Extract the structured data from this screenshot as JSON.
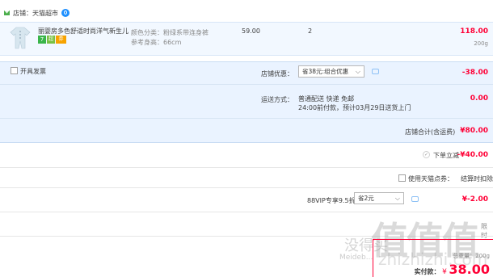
{
  "shop": {
    "label": "店铺：",
    "name": "天猫超市"
  },
  "item": {
    "title": "丽婴房多色舒适时尚洋气新生儿...",
    "spec_line1": "颜色分类：粉绿系带连身裤",
    "spec_line2": "参考身高：66cm",
    "price": "59.00",
    "qty": "2",
    "subtotal": "118.00",
    "weight": "200g",
    "badges": [
      "7",
      "超",
      "券"
    ]
  },
  "invoice": {
    "label": "开具发票"
  },
  "shop_discount": {
    "label": "店铺优惠：",
    "select": "省38元:组合优惠",
    "amount": "-38.00"
  },
  "shipping": {
    "label": "运送方式：",
    "line1": "普通配送 快递 免邮",
    "line2": "24:00前付款，预计03月29日送货上门",
    "amount": "0.00"
  },
  "shop_total": {
    "label": "店铺合计(含运费)",
    "amount": "¥80.00"
  },
  "instant_discount": {
    "label": "下单立减",
    "amount": "-¥40.00"
  },
  "tmall_points": {
    "label": "使用天猫点券：",
    "right": "结算时扣除"
  },
  "vip": {
    "label": "88VIP专享9.5折",
    "select": "省2元",
    "amount": "¥-2.00"
  },
  "summary": {
    "partial_right": "限时",
    "weight_label": "总重量：",
    "weight": "200g",
    "pay_label": "实付款：",
    "pay_amount": "38.00",
    "currency": "¥"
  },
  "watermark": {
    "brand": "值值值",
    "cn": "没得买",
    "url1": "Meideb...",
    "url2": "zhizhizhi.com"
  },
  "colors": {
    "accent_red": "#ff0036",
    "band_blue": "#e8f2ff",
    "tmall_blue": "#3f95ff"
  }
}
